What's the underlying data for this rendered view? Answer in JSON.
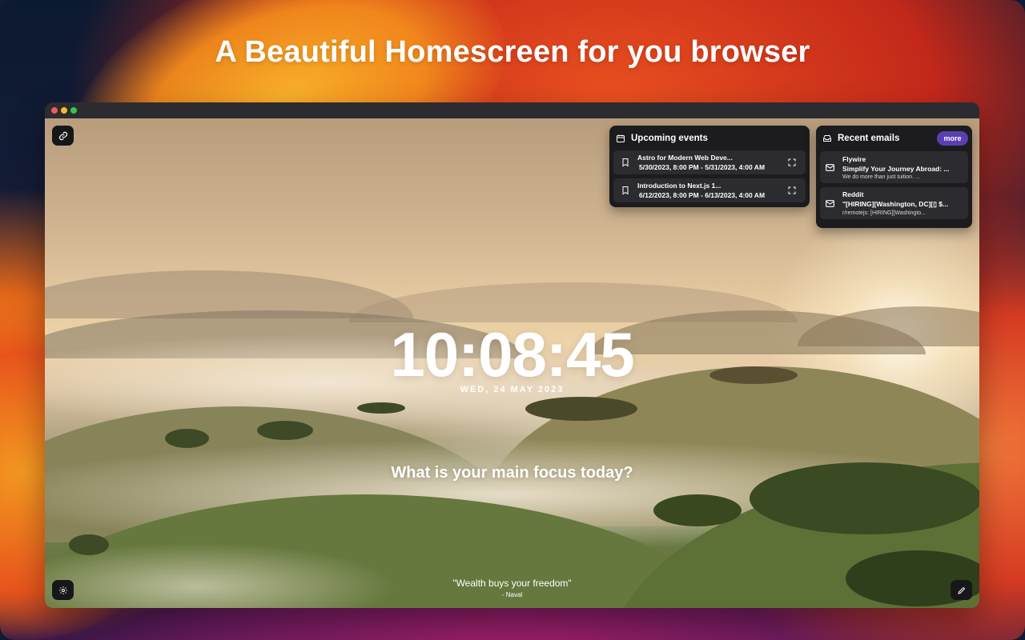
{
  "headline": "A Beautiful Homescreen for you browser",
  "colors": {
    "window_dot_close": "#ee5b56",
    "window_dot_minimize": "#f1bb2f",
    "window_dot_zoom": "#37c74a",
    "panel_bg": "#1c1c1f",
    "row_bg": "#2c2c30",
    "accent": "#5b3fb0"
  },
  "icons": {
    "links": "link-icon",
    "settings": "gear-icon",
    "edit": "pencil-icon",
    "events": "calendar-icon",
    "emails": "inbox-icon",
    "event_item": "bookmark-icon",
    "event_expand": "expand-icon",
    "email_item": "envelope-icon"
  },
  "events": {
    "title": "Upcoming events",
    "items": [
      {
        "title": "Astro for Modern Web Deve...",
        "date": "5/30/2023, 8:00 PM - 5/31/2023, 4:00 AM"
      },
      {
        "title": "Introduction to Next.js 1...",
        "date": "6/12/2023, 8:00 PM - 6/13/2023, 4:00 AM"
      }
    ]
  },
  "emails": {
    "title": "Recent emails",
    "more_label": "more",
    "items": [
      {
        "from": "Flywire",
        "subject": "Simplify Your Journey Abroad: ...",
        "preview": "We do more than just tuition. ..."
      },
      {
        "from": "Reddit",
        "subject": "\"[HIRING][Washington, DC][▯ $...",
        "preview": "r/remotejs: [HIRING][Washingto..."
      }
    ]
  },
  "clock": {
    "time": "10:08:45",
    "date": "WED, 24 MAY 2023"
  },
  "focus_prompt": "What is your main focus today?",
  "quote": {
    "text": "\"Wealth buys your freedom\"",
    "author": "- Naval"
  }
}
